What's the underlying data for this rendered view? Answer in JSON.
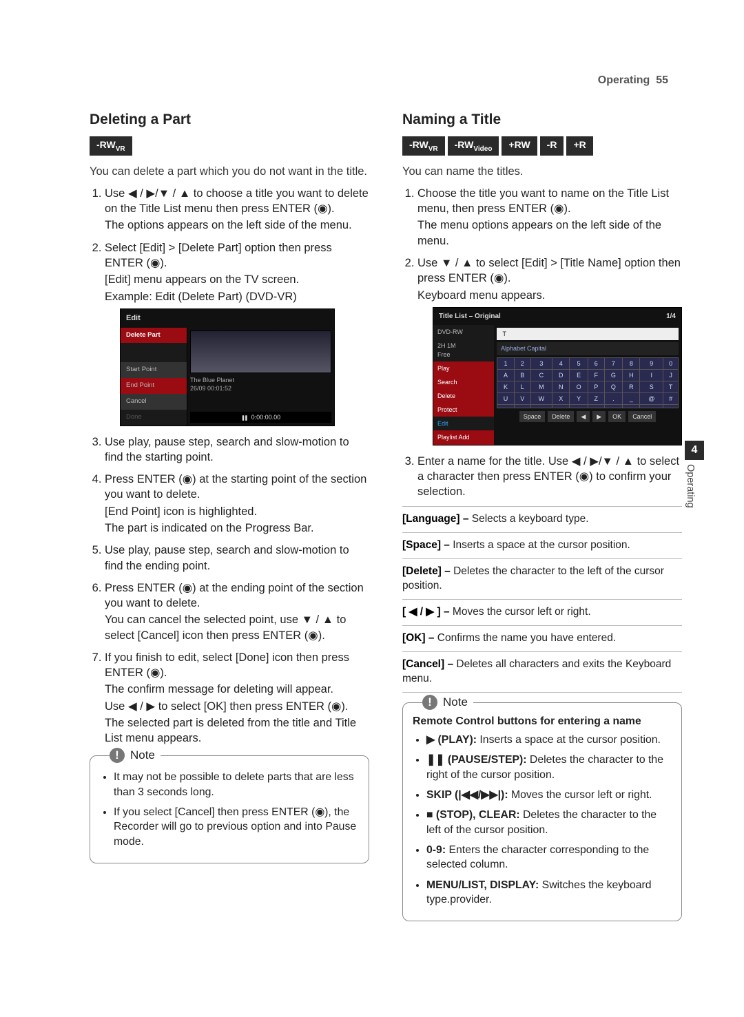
{
  "runningHead": {
    "section": "Operating",
    "page": "55"
  },
  "sideTab": {
    "num": "4",
    "label": "Operating"
  },
  "left": {
    "heading": "Deleting a Part",
    "badges": [
      "-RWVR"
    ],
    "intro": "You can delete a part which you do not want in the title.",
    "steps": {
      "s1a": "Use ",
      "s1b": " / ",
      "s1c": "/",
      "s1d": " / ",
      "s1e": " to choose a title you want to delete on the Title List menu then press ENTER (",
      "s1f": ").",
      "s1after": "The options appears on the left side of the menu.",
      "s2": "Select [Edit] > [Delete Part] option then press ENTER (",
      "s2b": ").",
      "s2after1": "[Edit] menu appears on the TV screen.",
      "s2after2": "Example: Edit (Delete Part) (DVD-VR)",
      "s3": "Use play, pause step, search and slow-motion to find the starting point.",
      "s4a": "Press ENTER (",
      "s4b": ") at the starting point of the section you want to delete.",
      "s4after1": "[End Point] icon is highlighted.",
      "s4after2": "The part is indicated on the Progress Bar.",
      "s5": "Use play, pause step, search and slow-motion to find the ending point.",
      "s6a": "Press ENTER (",
      "s6b": ") at the ending point of the section you want to delete.",
      "s6after_a": "You can cancel the selected point, use ",
      "s6after_b": " / ",
      "s6after_c": " to select [Cancel] icon then press ENTER (",
      "s6after_d": ").",
      "s7a": "If you finish to edit, select [Done] icon then press ENTER (",
      "s7b": ").",
      "s7after1": "The confirm message for deleting will appear.",
      "s7after2_a": "Use ",
      "s7after2_b": " / ",
      "s7after2_c": " to select [OK] then press ENTER (",
      "s7after2_d": ").",
      "s7after3": "The selected part is deleted from the title and Title List menu appears."
    },
    "shot": {
      "title": "Edit",
      "side": [
        "Delete Part",
        "Start Point",
        "End Point",
        "Cancel",
        "Done"
      ],
      "mediaTitle": "The Blue Planet",
      "mediaInfo": "26/09  00:01:52",
      "time": "0:00:00.00"
    },
    "noteLabel": "Note",
    "noteItems": [
      "It may not be possible to delete parts that are less than 3 seconds long.",
      "If you select [Cancel] then press ENTER (◉), the Recorder will go to previous option and into Pause mode."
    ]
  },
  "right": {
    "heading": "Naming a Title",
    "badges": [
      "-RWVR",
      "-RWVideo",
      "+RW",
      "-R",
      "+R"
    ],
    "intro": "You can name the titles.",
    "steps": {
      "s1a": "Choose the title you want to name on the Title List menu, then press ENTER (",
      "s1b": ").",
      "s1after": "The menu options appears on the left side of the menu.",
      "s2a": "Use ",
      "s2b": " / ",
      "s2c": " to select [Edit] > [Title Name] option then press ENTER (",
      "s2d": ").",
      "s2after": "Keyboard menu appears.",
      "s3a": "Enter a name for the title. Use ",
      "s3b": " / ",
      "s3c": "/",
      "s3d": " / ",
      "s3e": " to select a character then press ENTER (",
      "s3f": ") to confirm your selection."
    },
    "shot": {
      "header": "Title List – Original",
      "pager": "1/4",
      "disc": "DVD-RW",
      "free": "2H 1M\nFree",
      "keysetLabel": "Alphabet Capital",
      "side": [
        "Play",
        "Search",
        "Delete",
        "Protect",
        "Edit",
        "Playlist Add"
      ],
      "btnRow": [
        "Space",
        "Delete",
        "◀",
        "▶",
        "OK",
        "Cancel"
      ]
    },
    "defs": [
      {
        "k": "[Language] –",
        "v": " Selects a keyboard type."
      },
      {
        "k": "[Space] –",
        "v": " Inserts a space at the cursor position."
      },
      {
        "k": "[Delete] –",
        "v": " Deletes the character to the left of the cursor position."
      },
      {
        "k": "[ ◀ / ▶ ] –",
        "v": " Moves the cursor left or right."
      },
      {
        "k": "[OK] –",
        "v": " Confirms the name you have entered."
      },
      {
        "k": "[Cancel] –",
        "v": " Deletes all characters and exits the Keyboard menu."
      }
    ],
    "noteLabel": "Note",
    "noteHeading": "Remote Control buttons for entering a name",
    "noteItems": [
      {
        "pre": "▶ (PLAY):",
        "post": " Inserts a space at the cursor position."
      },
      {
        "pre": "❚❚ (PAUSE/STEP):",
        "post": " Deletes the character to the right of the cursor position."
      },
      {
        "pre": "SKIP (|◀◀/▶▶|):",
        "post": " Moves the cursor left or right."
      },
      {
        "pre": "■ (STOP), CLEAR:",
        "post": " Deletes the character to the left of the cursor position."
      },
      {
        "pre": "0-9:",
        "post": " Enters the character corresponding to the selected column."
      },
      {
        "pre": "MENU/LIST, DISPLAY:",
        "post": " Switches the keyboard type.provider."
      }
    ]
  },
  "chart_data": {
    "type": "table",
    "title": "On-screen keyboard grid",
    "rows": [
      [
        "1",
        "2",
        "3",
        "4",
        "5",
        "6",
        "7",
        "8",
        "9",
        "0"
      ],
      [
        "A",
        "B",
        "C",
        "D",
        "E",
        "F",
        "G",
        "H",
        "I",
        "J"
      ],
      [
        "K",
        "L",
        "M",
        "N",
        "O",
        "P",
        "Q",
        "R",
        "S",
        "T"
      ],
      [
        "U",
        "V",
        "W",
        "X",
        "Y",
        "Z",
        ".",
        "_",
        "@",
        "#"
      ],
      [
        "",
        "",
        "",
        "",
        "",
        "",
        "",
        "",
        "",
        ""
      ]
    ]
  }
}
